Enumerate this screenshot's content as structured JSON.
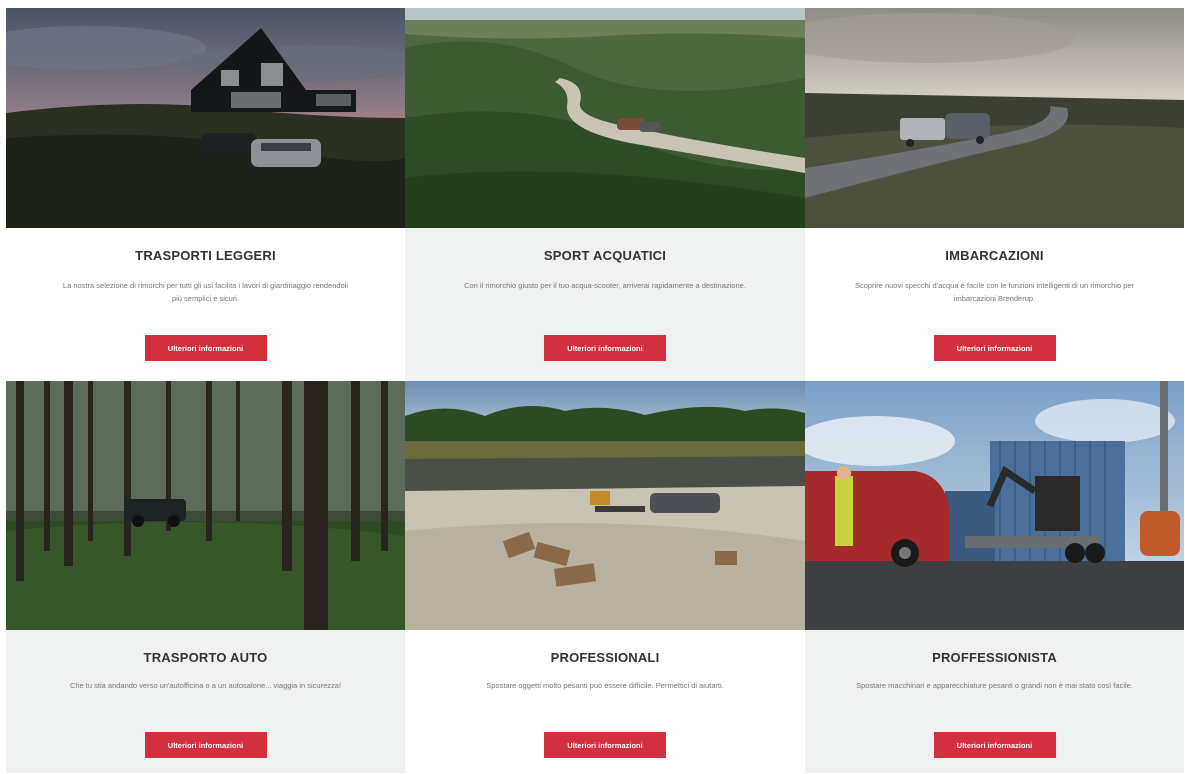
{
  "cards": [
    {
      "title": "TRASPORTI LEGGERI",
      "description": "La nostra selezione di rimorchi per tutti gli usi facilita i lavori di giardinaggio rendendoli più semplici e sicuri.",
      "button_label": "Ulteriori informazioni",
      "photo": "house-dusk-cars"
    },
    {
      "title": "SPORT ACQUATICI",
      "description": "Con il rimorchio giusto per il tuo acqua-scooter, arriverai rapidamente a destinazione.",
      "button_label": "Ulteriori informazioni",
      "photo": "dune-road-car"
    },
    {
      "title": "IMBARCAZIONI",
      "description": "Scoprire nuovi specchi d'acqua è facile con le funzioni intelligenti di un rimorchio per imbarcazioni Brenderup.",
      "button_label": "Ulteriori informazioni",
      "photo": "coastal-road-trailer"
    },
    {
      "title": "TRASPORTO AUTO",
      "description": "Che tu stia andando verso un'autofficina o a un autosalone... viaggia in sicurezza!",
      "button_label": "Ulteriori informazioni",
      "photo": "forest-jeep"
    },
    {
      "title": "PROFESSIONALI",
      "description": "Spostare oggetti molto pesanti può essere difficile. Permettici di aiutarti.",
      "button_label": "Ulteriori informazioni",
      "photo": "quarry-trailer"
    },
    {
      "title": "PROFFESSIONISTA",
      "description": "Spostare macchinari e apparecchiature pesanti o grandi non è mai stato così facile.",
      "button_label": "Ulteriori informazioni",
      "photo": "van-excavator"
    }
  ],
  "colors": {
    "button": "#d2303e",
    "grey_card": "#f0f1f1",
    "title": "#333333"
  }
}
